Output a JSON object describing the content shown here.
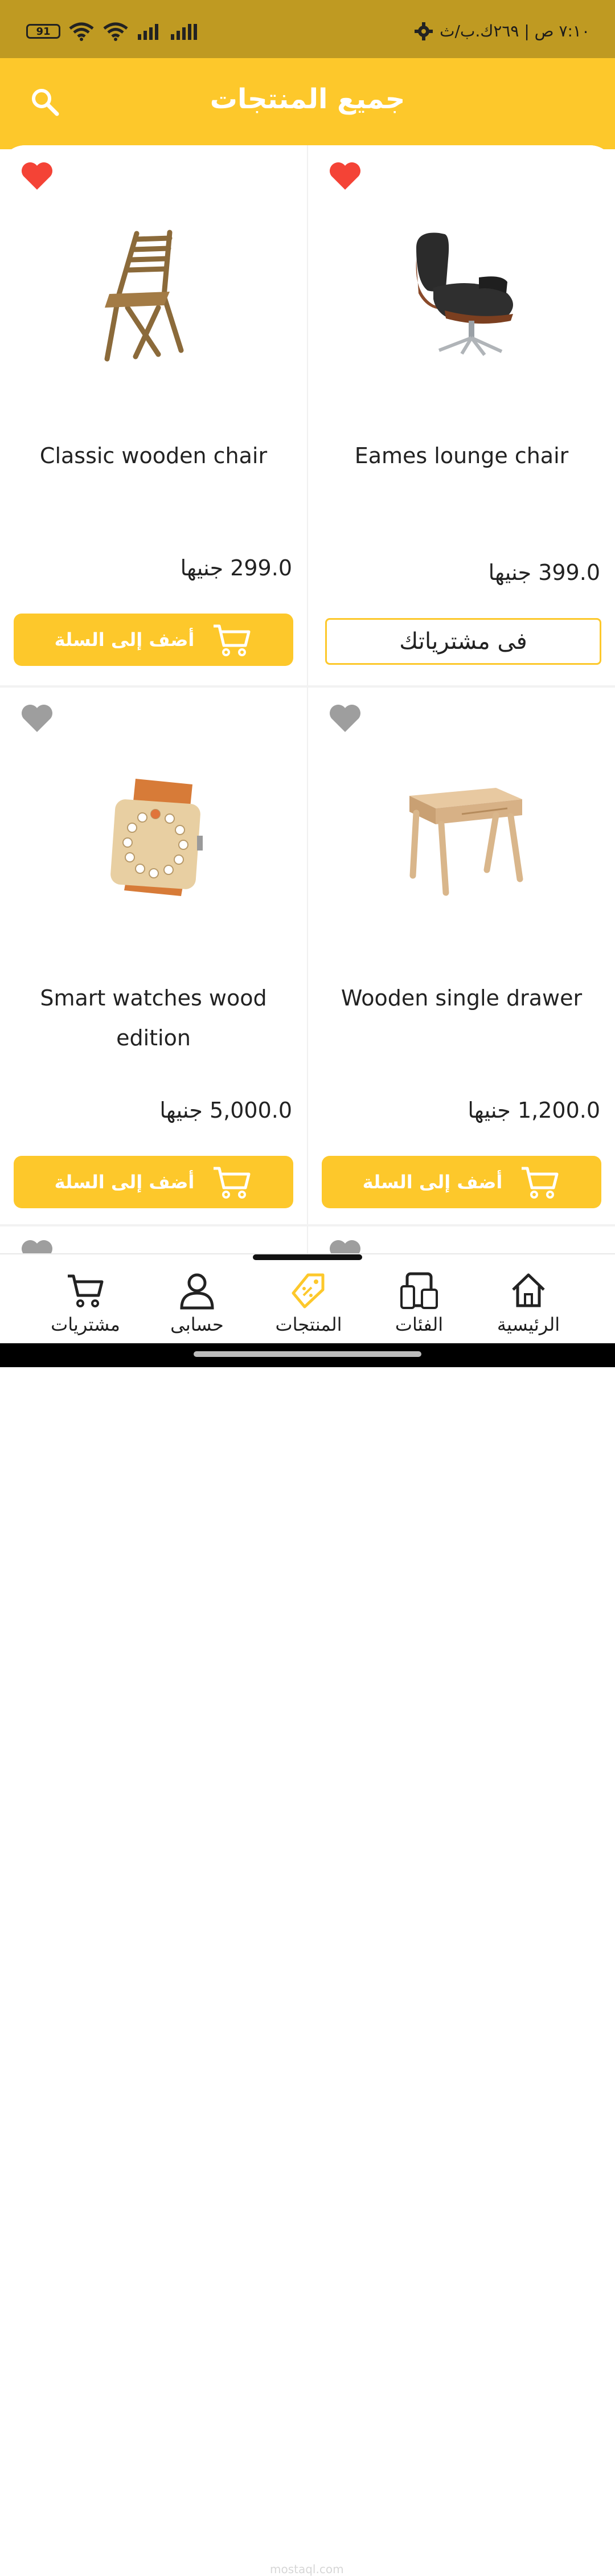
{
  "status_bar": {
    "battery": "91",
    "time_info": "٧:١٠ ص | ٢٦٩ك.ب/ث"
  },
  "app_bar": {
    "title": "جميع المنتجات"
  },
  "products": [
    {
      "name": "Eames lounge chair",
      "price": "399.0 جنيها",
      "favorite": true,
      "action": "owned",
      "action_label": "فى مشترياتك",
      "image_icon": "lounge-chair"
    },
    {
      "name": "Classic wooden chair",
      "price": "299.0 جنيها",
      "favorite": true,
      "action": "add",
      "action_label": "أضف إلى السلة",
      "image_icon": "wooden-chair"
    },
    {
      "name": "Wooden single drawer",
      "price": "1,200.0 جنيها",
      "favorite": false,
      "action": "add",
      "action_label": "أضف إلى السلة",
      "image_icon": "wooden-table"
    },
    {
      "name": "Smart watches wood edition",
      "price": "5,000.0 جنيها",
      "favorite": false,
      "action": "add",
      "action_label": "أضف إلى السلة",
      "image_icon": "wood-watch"
    }
  ],
  "bottom_nav": {
    "items": [
      {
        "label": "الرئيسية",
        "icon": "home-icon",
        "active": false
      },
      {
        "label": "الفئات",
        "icon": "devices-icon",
        "active": false
      },
      {
        "label": "المنتجات",
        "icon": "tag-icon",
        "active": true
      },
      {
        "label": "حسابى",
        "icon": "user-icon",
        "active": false
      },
      {
        "label": "مشتريات",
        "icon": "cart-icon",
        "active": false
      }
    ]
  },
  "watermark": "mostaql.com",
  "colors": {
    "accent": "#fdc82b",
    "status_bar": "#bf9a22",
    "heart_active": "#f44336",
    "heart_inactive": "#9e9e9e"
  }
}
